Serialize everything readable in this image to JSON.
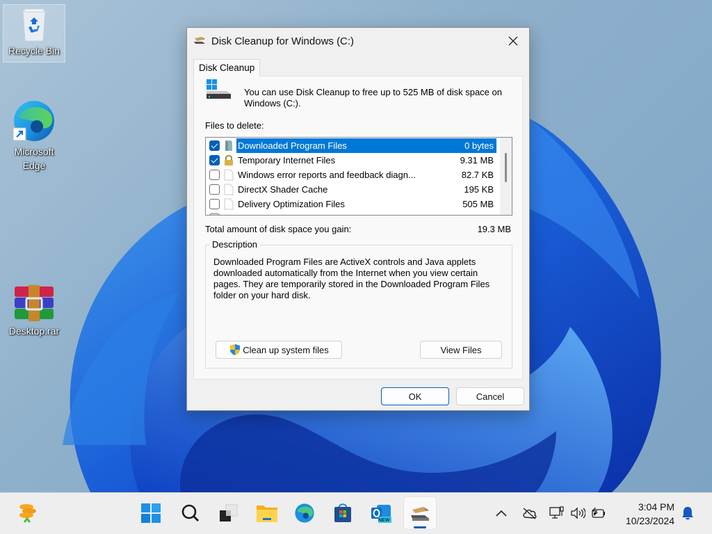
{
  "desktop": {
    "icons": [
      {
        "label": "Recycle Bin",
        "icon": "recycle-bin-icon",
        "selected": true
      },
      {
        "label": "Microsoft Edge",
        "icon": "edge-icon"
      },
      {
        "label": "Desktop.rar",
        "icon": "winrar-archive-icon"
      }
    ]
  },
  "dialog": {
    "title": "Disk Cleanup for Windows (C:)",
    "tab_label": "Disk Cleanup",
    "intro_text": "You can use Disk Cleanup to free up to 525 MB of disk space on Windows (C:).",
    "files_to_delete_label": "Files to delete:",
    "files": [
      {
        "name": "Downloaded Program Files",
        "size": "0 bytes",
        "checked": true,
        "selected": true,
        "icon": "folder-icon"
      },
      {
        "name": "Temporary Internet Files",
        "size": "9.31 MB",
        "checked": true,
        "selected": false,
        "icon": "lock-icon"
      },
      {
        "name": "Windows error reports and feedback diagn...",
        "size": "82.7 KB",
        "checked": false,
        "selected": false,
        "icon": "file-icon"
      },
      {
        "name": "DirectX Shader Cache",
        "size": "195 KB",
        "checked": false,
        "selected": false,
        "icon": "file-icon"
      },
      {
        "name": "Delivery Optimization Files",
        "size": "505 MB",
        "checked": false,
        "selected": false,
        "icon": "file-icon"
      }
    ],
    "total_label": "Total amount of disk space you gain:",
    "total_value": "19.3 MB",
    "description_legend": "Description",
    "description_text": "Downloaded Program Files are ActiveX controls and Java applets downloaded automatically from the Internet when you view certain pages. They are temporarily stored in the Downloaded Program Files folder on your hard disk.",
    "cleanup_system_files_label": "Clean up system files",
    "view_files_label": "View Files",
    "ok_label": "OK",
    "cancel_label": "Cancel"
  },
  "taskbar": {
    "pinned": [
      "start-icon",
      "search-icon",
      "task-view-icon",
      "file-explorer-icon",
      "edge-icon",
      "microsoft-store-icon",
      "outlook-new-icon",
      "disk-cleanup-icon"
    ],
    "active": "disk-cleanup-icon",
    "outlook_badge": "NEW",
    "time": "3:04 PM",
    "date": "10/23/2024"
  },
  "colors": {
    "accent": "#005fb8",
    "selection": "#0078d7"
  }
}
